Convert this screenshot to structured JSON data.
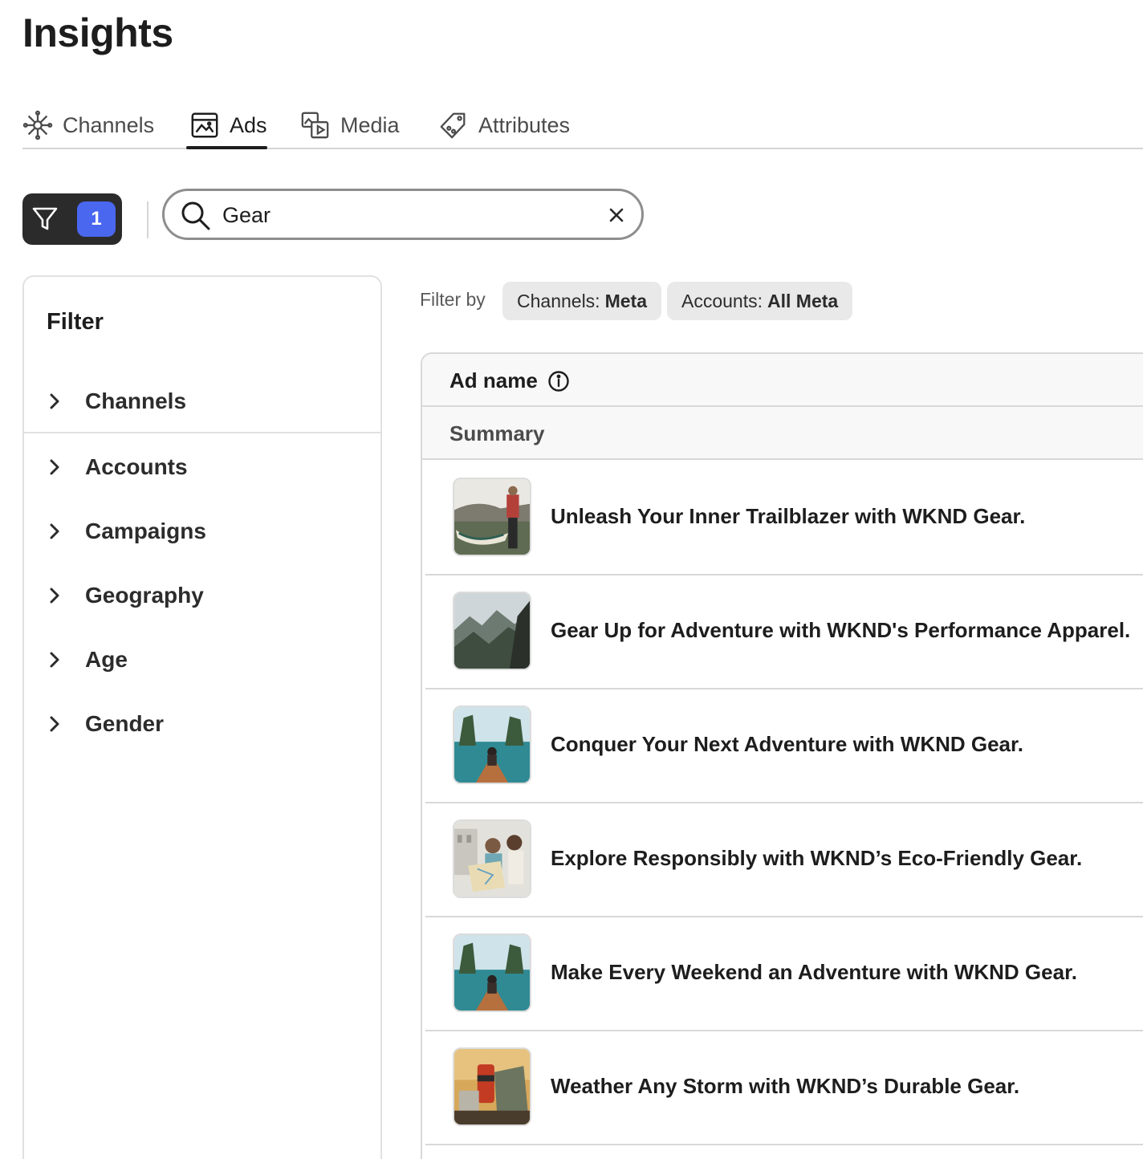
{
  "page": {
    "title": "Insights"
  },
  "tabs": [
    {
      "label": "Channels",
      "icon": "channels-icon",
      "active": false
    },
    {
      "label": "Ads",
      "icon": "ads-icon",
      "active": true
    },
    {
      "label": "Media",
      "icon": "media-icon",
      "active": false
    },
    {
      "label": "Attributes",
      "icon": "attributes-icon",
      "active": false
    }
  ],
  "toolbar": {
    "filter_count": "1",
    "search": {
      "value": "Gear",
      "placeholder": ""
    }
  },
  "filter_panel": {
    "heading": "Filter",
    "items": [
      "Channels",
      "Accounts",
      "Campaigns",
      "Geography",
      "Age",
      "Gender"
    ]
  },
  "filter_by": {
    "label": "Filter by",
    "chips": [
      {
        "key": "Channels:",
        "value": "Meta"
      },
      {
        "key": "Accounts:",
        "value": "All Meta"
      }
    ]
  },
  "table": {
    "column_header": "Ad name",
    "summary_label": "Summary",
    "rows": [
      {
        "name": "Unleash Your Inner Trailblazer with WKND Gear.",
        "thumbnail": "lake-hiker-image"
      },
      {
        "name": "Gear Up for Adventure with WKND's Performance Apparel.",
        "thumbnail": "mountain-ridge-image"
      },
      {
        "name": "Conquer Your Next Adventure with WKND Gear.",
        "thumbnail": "boat-lagoon-image"
      },
      {
        "name": "Explore Responsibly with WKND’s Eco-Friendly Gear.",
        "thumbnail": "travelers-map-image"
      },
      {
        "name": "Make Every Weekend an Adventure with WKND Gear.",
        "thumbnail": "boat-lagoon-image"
      },
      {
        "name": "Weather Any Storm with WKND’s Durable Gear.",
        "thumbnail": "camping-gear-image"
      }
    ]
  },
  "colors": {
    "accent": "#4a67f0",
    "dark_button": "#2b2b2b",
    "chip_bg": "#e9e9e9"
  }
}
